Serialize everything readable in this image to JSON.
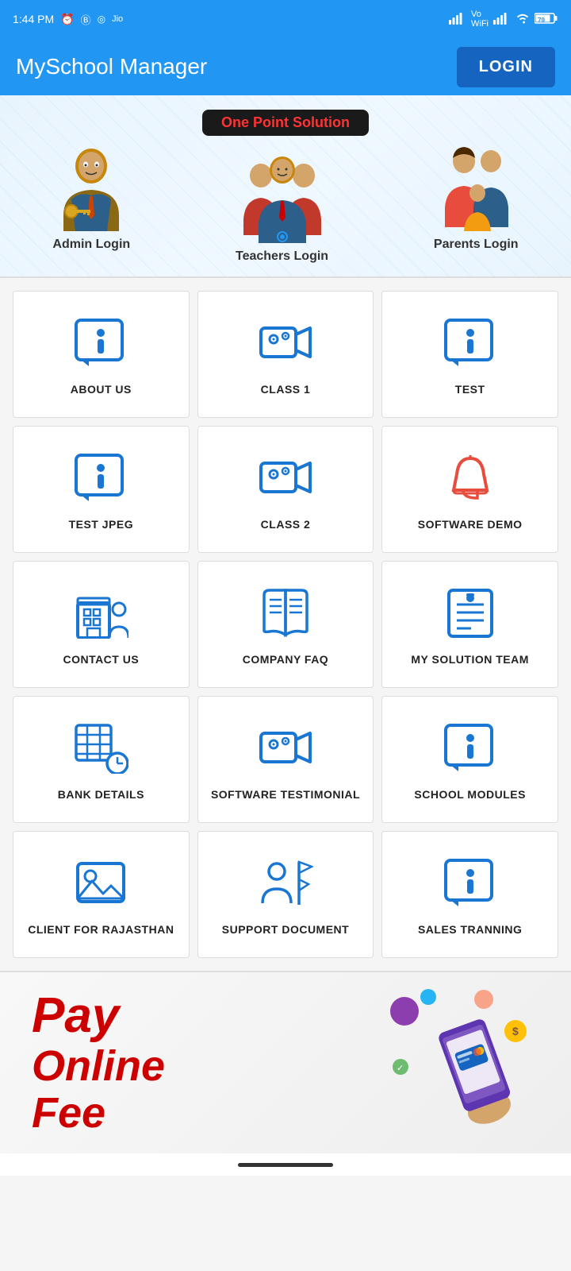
{
  "statusBar": {
    "time": "1:44 PM",
    "battery": "79"
  },
  "header": {
    "title": "MySchool Manager",
    "loginLabel": "LOGIN"
  },
  "banner": {
    "tagline": "One Point Solution",
    "adminLabel": "Admin Login",
    "teachersLabel": "Teachers Login",
    "parentsLabel": "Parents Login"
  },
  "grid": {
    "items": [
      {
        "id": "about-us",
        "label": "ABOUT US",
        "icon": "info-chat"
      },
      {
        "id": "class-1",
        "label": "CLASS 1",
        "icon": "video-camera"
      },
      {
        "id": "test",
        "label": "TEST",
        "icon": "info-chat"
      },
      {
        "id": "test-jpeg",
        "label": "TEST JPEG",
        "icon": "info-chat"
      },
      {
        "id": "class-2",
        "label": "CLASS 2",
        "icon": "video-camera"
      },
      {
        "id": "software-demo",
        "label": "SOFTWARE DEMO",
        "icon": "bell"
      },
      {
        "id": "contact-us",
        "label": "CONTACT US",
        "icon": "building-person"
      },
      {
        "id": "company-faq",
        "label": "COMPANY FAQ",
        "icon": "book"
      },
      {
        "id": "my-solution-team",
        "label": "MY SOLUTION TEAM",
        "icon": "document-list"
      },
      {
        "id": "bank-details",
        "label": "BANK DETAILS",
        "icon": "table-clock"
      },
      {
        "id": "software-testimonial",
        "label": "SOFTWARE TESTIMONIAL",
        "icon": "video-camera"
      },
      {
        "id": "school-modules",
        "label": "SCHOOL MODULES",
        "icon": "info-chat"
      },
      {
        "id": "client-rajasthan",
        "label": "CLIENT FOR RAJASTHAN",
        "icon": "image"
      },
      {
        "id": "support-document",
        "label": "SUPPORT DOCUMENT",
        "icon": "people-flags"
      },
      {
        "id": "sales-tranning",
        "label": "SALES TRANNING",
        "icon": "info-chat"
      }
    ]
  },
  "bottomBanner": {
    "line1": "Pay",
    "line2": "Online",
    "line3": "Fee"
  }
}
